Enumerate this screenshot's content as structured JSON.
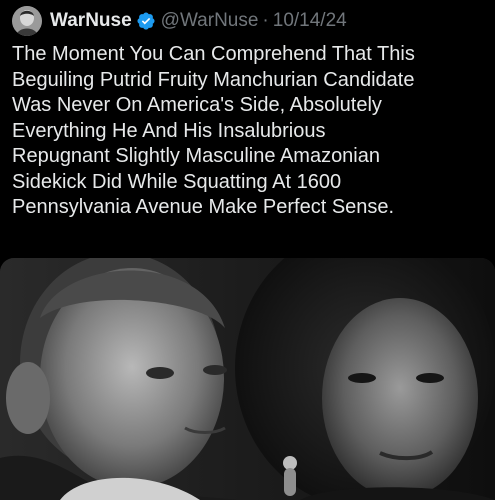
{
  "tweet": {
    "author": {
      "display_name": "WarNuse",
      "handle": "@WarNuse",
      "verified_badge_icon": "verified-badge-icon",
      "avatar_icon": "avatar-image"
    },
    "separator": "·",
    "date": "10/14/24",
    "text": "The Moment You Can Comprehend That This\nBeguiling Putrid Fruity Manchurian Candidate\nWas Never On America's Side, Absolutely\nEverything He And His Insalubrious\nRepugnant Slightly Masculine Amazonian\nSidekick Did While Squatting At 1600\nPennsylvania Avenue Make Perfect Sense.",
    "media": {
      "type": "photo",
      "style": "black-and-white"
    }
  },
  "colors": {
    "background": "#000000",
    "text_primary": "#e7e9ea",
    "text_secondary": "#71767b",
    "verified_blue": "#1d9bf0"
  }
}
